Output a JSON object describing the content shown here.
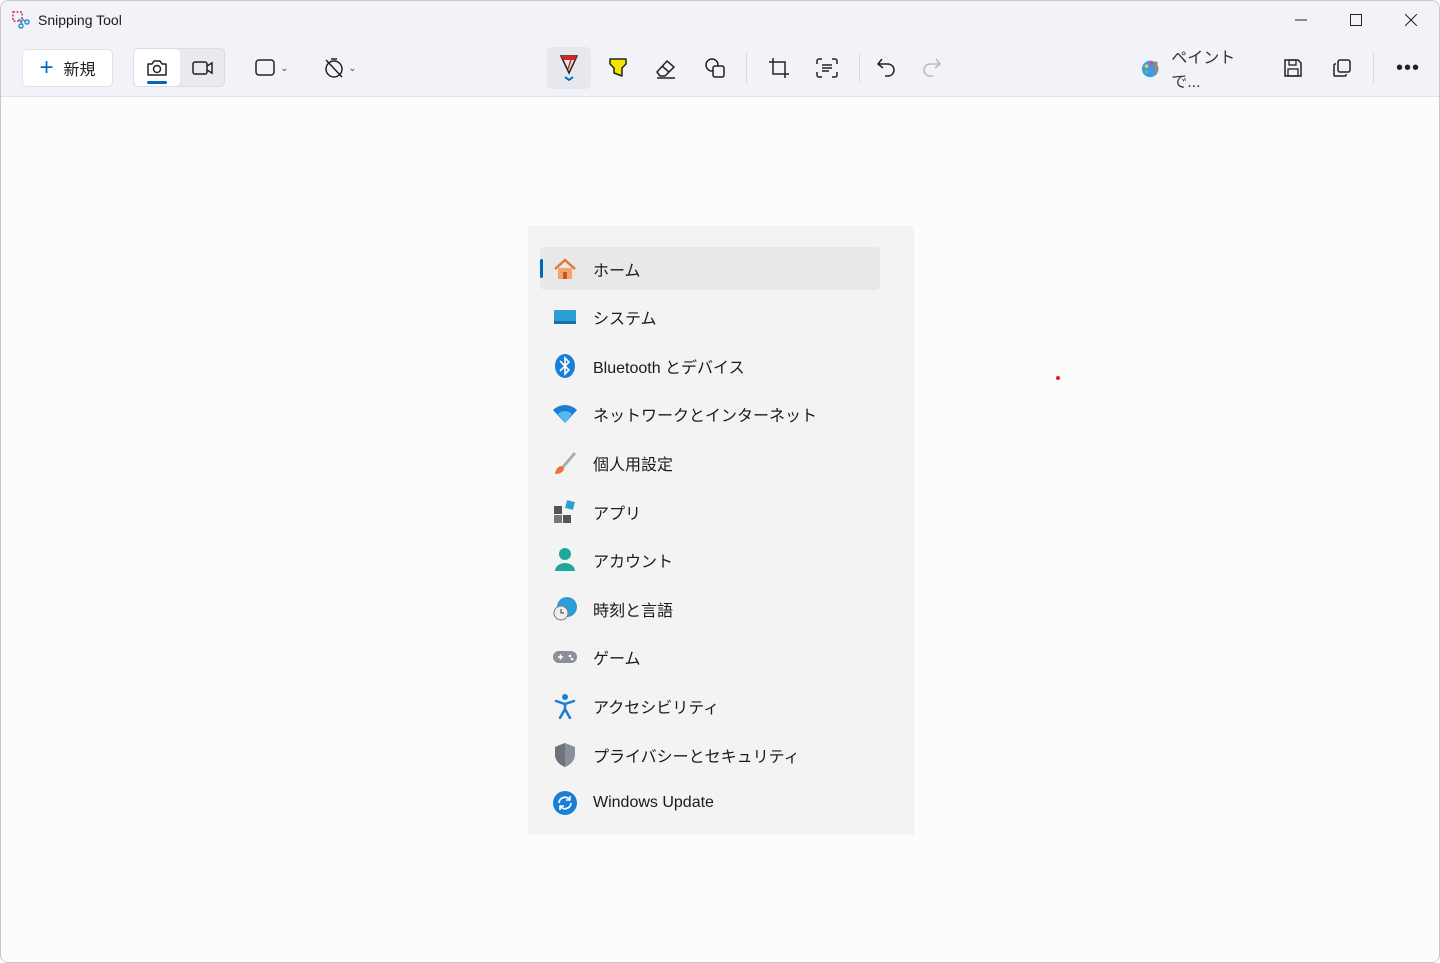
{
  "window": {
    "title": "Snipping Tool"
  },
  "toolbar": {
    "new_label": "新規",
    "paint_label": "ペイントで..."
  },
  "menu": {
    "items": [
      {
        "label": "ホーム",
        "icon": "home-icon",
        "selected": true
      },
      {
        "label": "システム",
        "icon": "system-icon"
      },
      {
        "label": "Bluetooth とデバイス",
        "icon": "bluetooth-icon"
      },
      {
        "label": "ネットワークとインターネット",
        "icon": "wifi-icon"
      },
      {
        "label": "個人用設定",
        "icon": "brush-icon"
      },
      {
        "label": "アプリ",
        "icon": "apps-icon"
      },
      {
        "label": "アカウント",
        "icon": "account-icon"
      },
      {
        "label": "時刻と言語",
        "icon": "time-language-icon"
      },
      {
        "label": "ゲーム",
        "icon": "gamepad-icon"
      },
      {
        "label": "アクセシビリティ",
        "icon": "accessibility-icon"
      },
      {
        "label": "プライバシーとセキュリティ",
        "icon": "shield-icon"
      },
      {
        "label": "Windows Update",
        "icon": "update-icon"
      }
    ]
  }
}
